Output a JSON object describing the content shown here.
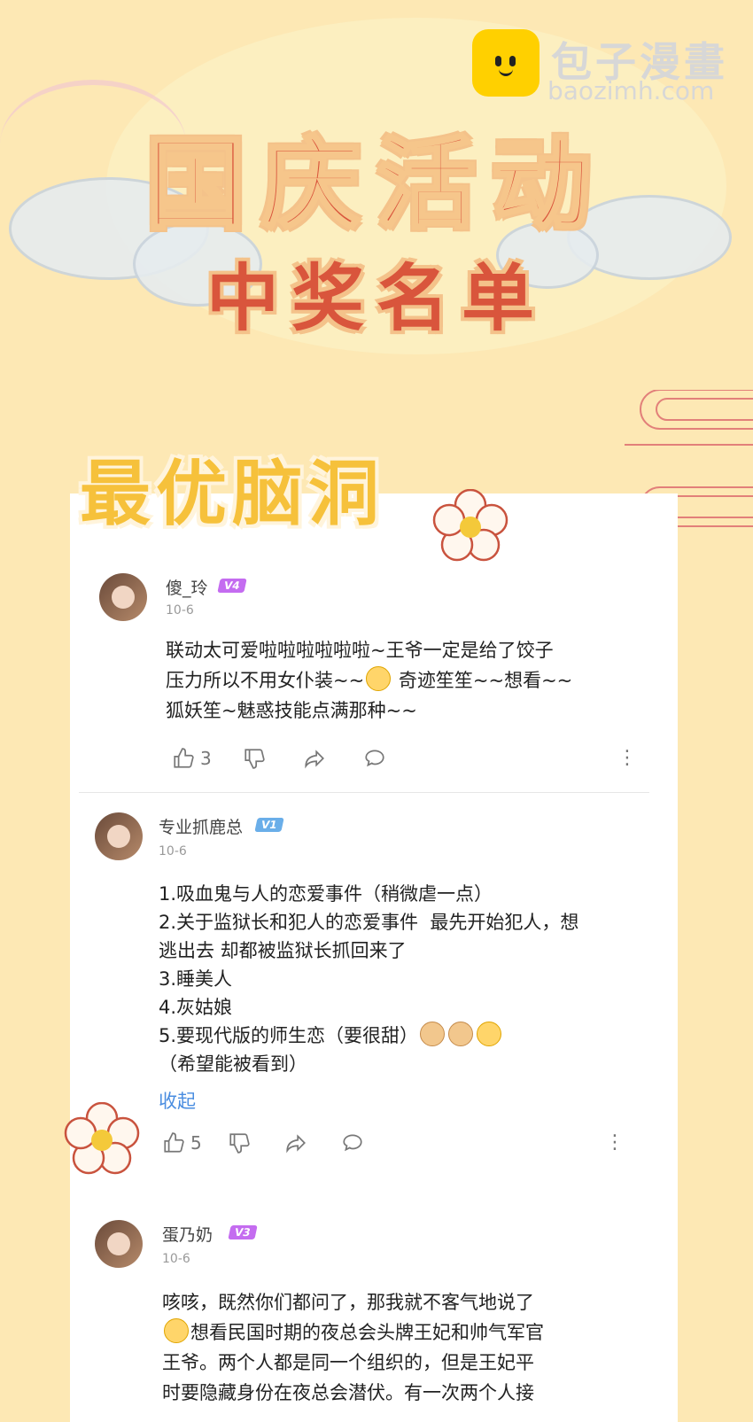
{
  "logo": {
    "name_cn": "包子漫畫",
    "domain": "baozimh.com"
  },
  "title": {
    "line1": "国庆活动",
    "line2": "中奖名单"
  },
  "section": {
    "title": "最优脑洞"
  },
  "comments": [
    {
      "username": "傻_玲",
      "level": "V4",
      "date": "10-6",
      "text_lines": [
        "联动太可爱啦啦啦啦啦啦~王爷一定是给了饺子",
        "压力所以不用女仆装~~",
        " 奇迹笙笙~~想看~~",
        "狐妖笙~魅惑技能点满那种~~"
      ],
      "likes": "3"
    },
    {
      "username": "专业抓鹿总",
      "level": "V1",
      "date": "10-6",
      "text_lines": [
        "1.吸血鬼与人的恋爱事件（稍微虐一点）",
        "2.关于监狱长和犯人的恋爱事件  最先开始犯人，想",
        "逃出去 却都被监狱长抓回来了",
        "3.睡美人",
        "4.灰姑娘",
        "5.要现代版的师生恋（要很甜）",
        "（希望能被看到）"
      ],
      "collapse_label": "收起",
      "likes": "5"
    },
    {
      "username": "蛋乃奶",
      "level": "V3",
      "date": "10-6",
      "text_lines": [
        "咳咳，既然你们都问了，那我就不客气地说了",
        "想看民国时期的夜总会头牌王妃和帅气军官",
        "王爷。两个人都是同一个组织的，但是王妃平",
        "时要隐藏身份在夜总会潜伏。有一次两个人接"
      ]
    }
  ],
  "colors": {
    "background": "#fde8b4",
    "title": "#d9553c",
    "section": "#f6c13b",
    "link": "#4a8de0"
  },
  "icons": [
    "like-icon",
    "dislike-icon",
    "share-icon",
    "reply-icon",
    "more-icon",
    "flower-icon"
  ]
}
